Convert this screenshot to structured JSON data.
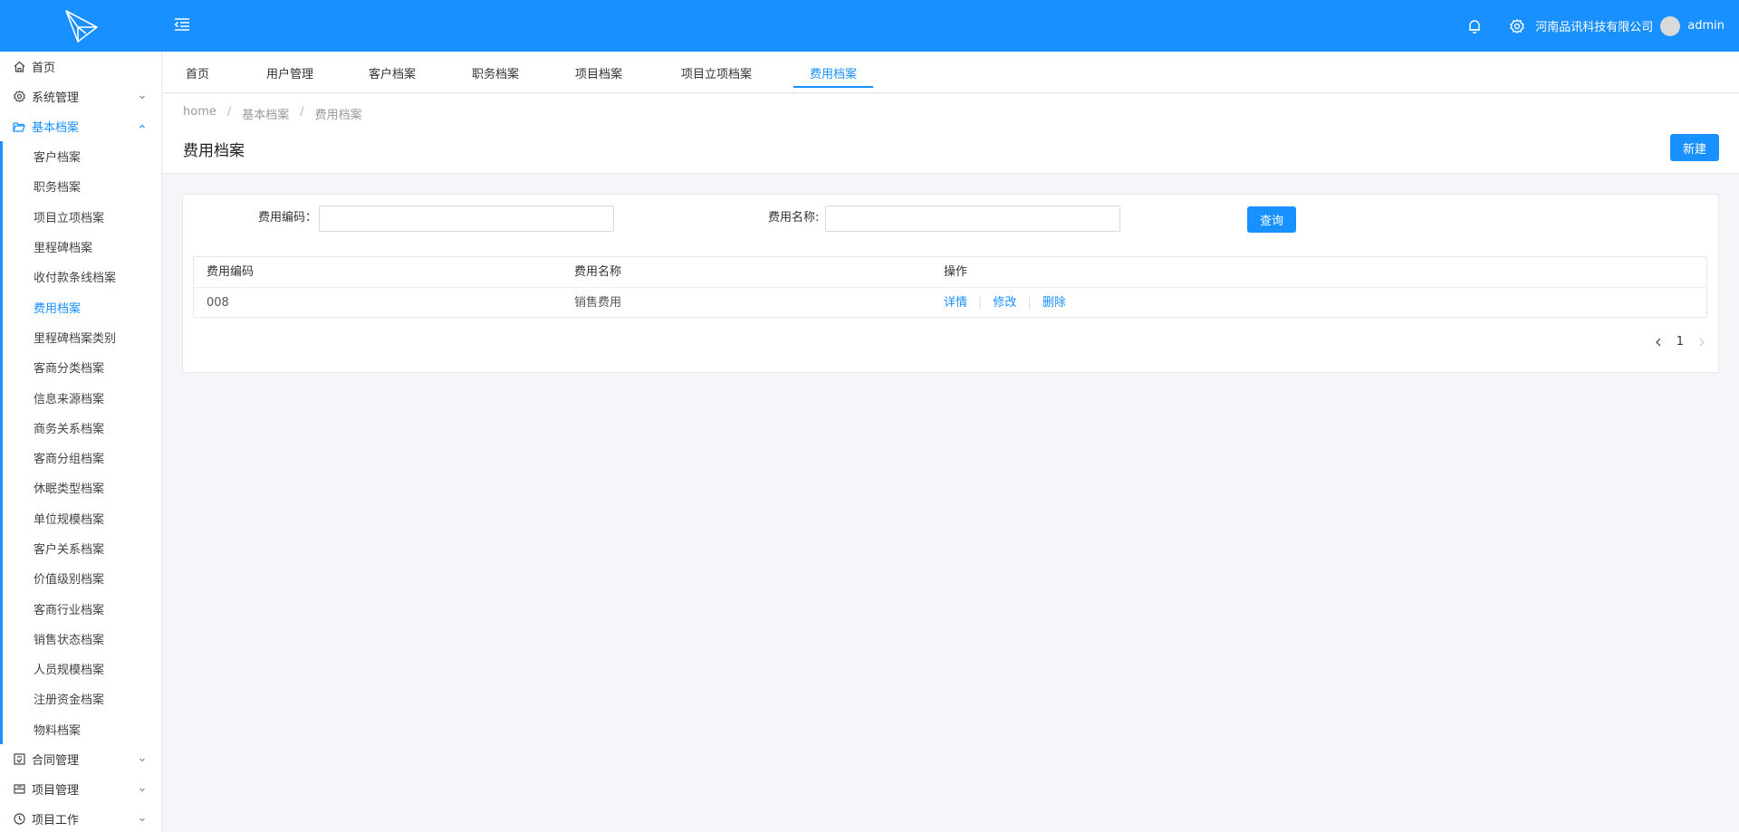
{
  "header": {
    "company": "河南品讯科技有限公司",
    "username": "admin"
  },
  "sidebar": {
    "items": [
      {
        "label": "首页",
        "icon": "home-icon"
      },
      {
        "label": "系统管理",
        "icon": "gear-icon"
      },
      {
        "label": "基本档案",
        "icon": "folder-open-icon"
      }
    ],
    "sub_items": [
      "客户档案",
      "职务档案",
      "项目立项档案",
      "里程碑档案",
      "收付款条线档案",
      "费用档案",
      "里程碑档案类别",
      "客商分类档案",
      "信息来源档案",
      "商务关系档案",
      "客商分组档案",
      "休眠类型档案",
      "单位规模档案",
      "客户关系档案",
      "价值级别档案",
      "客商行业档案",
      "销售状态档案",
      "人员规模档案",
      "注册资金档案",
      "物料档案"
    ],
    "active_sub": "费用档案",
    "bottom_items": [
      {
        "label": "合同管理",
        "icon": "contract-icon"
      },
      {
        "label": "项目管理",
        "icon": "project-icon"
      },
      {
        "label": "项目工作",
        "icon": "clock-icon"
      }
    ]
  },
  "tabs": [
    "首页",
    "用户管理",
    "客户档案",
    "职务档案",
    "项目档案",
    "项目立项档案",
    "费用档案"
  ],
  "active_tab": "费用档案",
  "breadcrumb": [
    "home",
    "基本档案",
    "费用档案"
  ],
  "page": {
    "title": "费用档案",
    "new_label": "新建"
  },
  "filters": {
    "code_label": "费用编码：",
    "code_value": "",
    "name_label": "费用名称:",
    "name_value": "",
    "query_label": "查询"
  },
  "table": {
    "columns": [
      "费用编码",
      "费用名称",
      "操作"
    ],
    "rows": [
      {
        "code": "008",
        "name": "销售费用"
      }
    ],
    "actions": [
      "详情",
      "修改",
      "删除"
    ]
  },
  "pagination": {
    "current_page": "1"
  },
  "colors": {
    "primary": "#1890ff"
  }
}
